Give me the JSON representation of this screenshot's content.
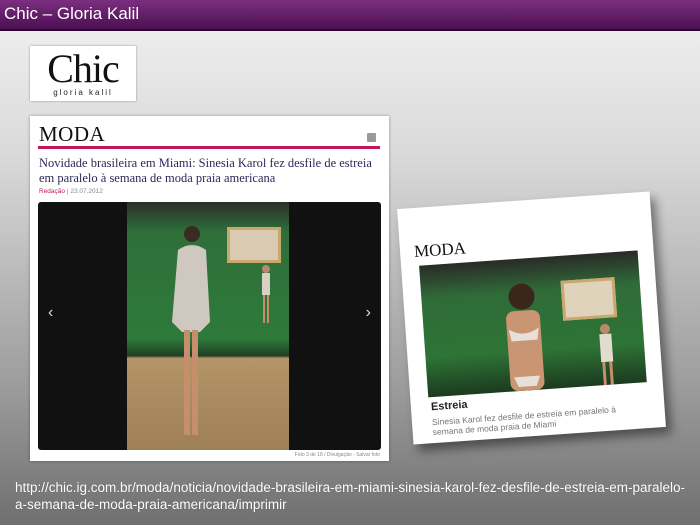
{
  "slide": {
    "title": "Chic – Gloria Kalil",
    "url": "http://chic.ig.com.br/moda/noticia/novidade-brasileira-em-miami-sinesia-karol-fez-desfile-de-estreia-em-paralelo-a-semana-de-moda-praia-americana/imprimir"
  },
  "logo": {
    "brand": "Chic",
    "tagline": "gloria kalil"
  },
  "article": {
    "section": "MODA",
    "headline": "Novidade brasileira em Miami: Sinesia Karol fez desfile de estreia em paralelo à semana de moda praia americana",
    "author": "Redação",
    "date": "| 23.07.2012",
    "prev_arrow": "‹",
    "next_arrow": "›",
    "photo_credit": "Foto 3 de 18 / Divulgação - Salvar foto"
  },
  "teaser": {
    "section": "MODA",
    "title": "Estreia",
    "description": "Sinesia Karol fez desfile de estreia em paralelo à semana de moda praia de Miami"
  },
  "colors": {
    "title_bar": "#5a1660",
    "accent": "#c2185b"
  },
  "icons": {
    "feed": "rss-icon"
  }
}
